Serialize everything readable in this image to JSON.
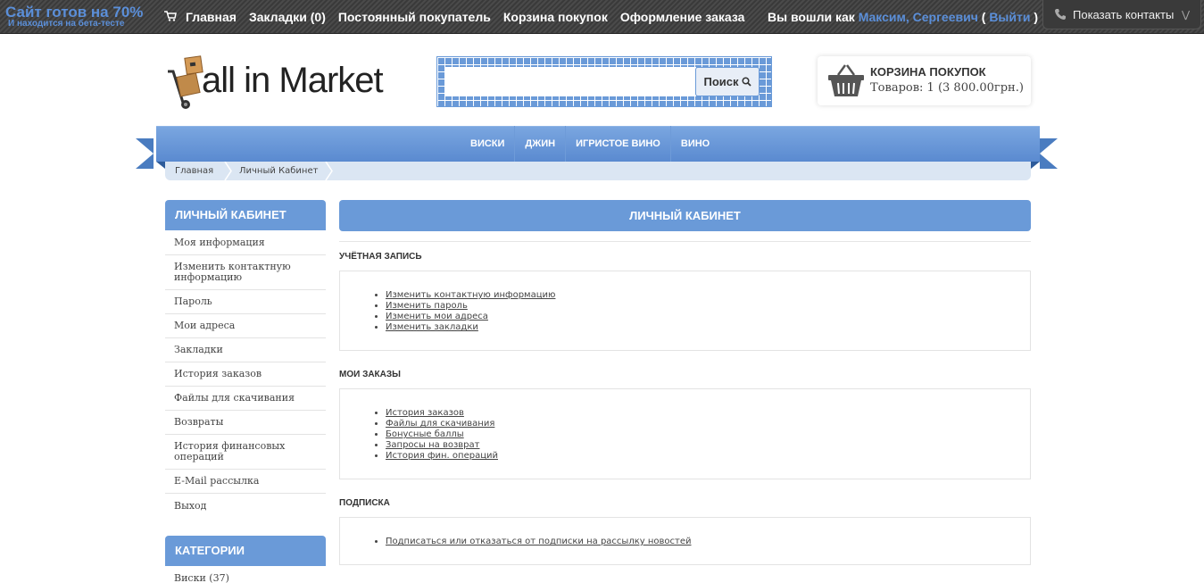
{
  "topbar": {
    "beta_main": "Сайт готов на 70%",
    "beta_sub": "И находится на бета-тесте",
    "nav": [
      "Главная",
      "Закладки (0)",
      "Постоянный покупатель",
      "Корзина покупок",
      "Оформление заказа"
    ],
    "login_prefix": "Вы вошли как",
    "user_name": "Максим, Сергеевич",
    "paren_open": "(",
    "logout": "Выйти",
    "paren_close": ")",
    "contacts_button": "Показать контакты"
  },
  "header": {
    "logo_text": "all in Market",
    "search_placeholder": "",
    "search_button": "Поиск",
    "cart_title": "КОРЗИНА ПОКУПОК",
    "cart_summary": "Товаров: 1 (3 800.00грн.)"
  },
  "menu": [
    "ВИСКИ",
    "ДЖИН",
    "ИГРИСТОЕ ВИНО",
    "ВИНО"
  ],
  "breadcrumb": [
    "Главная",
    "Личный Кабинет"
  ],
  "sidebar": {
    "account_title": "ЛИЧНЫЙ КАБИНЕТ",
    "items": [
      "Моя информация",
      "Изменить контактную информацию",
      "Пароль",
      "Мои адреса",
      "Закладки",
      "История заказов",
      "Файлы для скачивания",
      "Возвраты",
      "История финансовых операций",
      "E-Mail рассылка",
      "Выход"
    ],
    "categories_title": "КАТЕГОРИИ",
    "categories": [
      "Виски (37)"
    ]
  },
  "main": {
    "title": "ЛИЧНЫЙ КАБИНЕТ",
    "sections": [
      {
        "title": "УЧЁТНАЯ ЗАПИСЬ",
        "links": [
          "Изменить контактную информацию",
          "Изменить пароль",
          "Изменить мои адреса",
          "Изменить закладки"
        ]
      },
      {
        "title": "МОИ ЗАКАЗЫ",
        "links": [
          "История заказов",
          "Файлы для скачивания",
          "Бонусные баллы",
          "Запросы на возврат",
          "История фин. операций"
        ]
      },
      {
        "title": "ПОДПИСКА",
        "links": [
          "Подписаться или отказаться от подписки на рассылку новостей"
        ]
      }
    ]
  },
  "colors": {
    "accent": "#6a9ad8",
    "topbar": "#3f3f3f",
    "link_blue": "#5b8fd9"
  }
}
